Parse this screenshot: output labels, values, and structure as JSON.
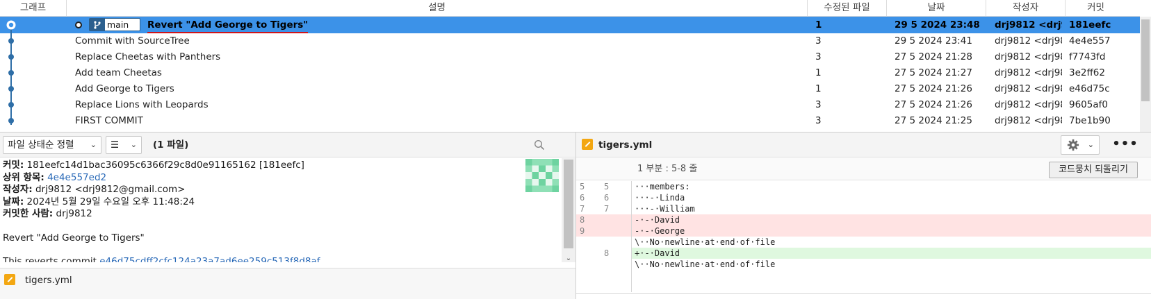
{
  "columns": {
    "graph": "그래프",
    "description": "설명",
    "files": "수정된 파일",
    "date": "날짜",
    "author": "작성자",
    "commit": "커밋"
  },
  "branch": {
    "name": "main",
    "icon": "branch-icon"
  },
  "commits": [
    {
      "message": "Revert \"Add George to Tigers\"",
      "files": "1",
      "date": "29 5 2024 23:48",
      "author": "drj9812 <drj9812",
      "hash": "181eefc",
      "selected": true
    },
    {
      "message": "Commit with SourceTree",
      "files": "3",
      "date": "29 5 2024 23:41",
      "author": "drj9812 <drj9812@",
      "hash": "4e4e557"
    },
    {
      "message": "Replace Cheetas with Panthers",
      "files": "3",
      "date": "27 5 2024 21:28",
      "author": "drj9812 <drj9812@",
      "hash": "f7743fd"
    },
    {
      "message": "Add team Cheetas",
      "files": "1",
      "date": "27 5 2024 21:27",
      "author": "drj9812 <drj9812@",
      "hash": "3e2ff62"
    },
    {
      "message": "Add George to Tigers",
      "files": "1",
      "date": "27 5 2024 21:26",
      "author": "drj9812 <drj9812@",
      "hash": "e46d75c"
    },
    {
      "message": "Replace Lions with Leopards",
      "files": "3",
      "date": "27 5 2024 21:26",
      "author": "drj9812 <drj9812@",
      "hash": "9605af0"
    },
    {
      "message": "FIRST COMMIT",
      "files": "3",
      "date": "27 5 2024 21:25",
      "author": "drj9812 <drj9812@",
      "hash": "7be1b90"
    }
  ],
  "left_toolbar": {
    "sort_label": "파일 상태순 정렬",
    "view_icon": "☰",
    "file_count": "(1 파일)"
  },
  "commit_details": {
    "commit_label": "커밋:",
    "commit_value": "181eefc14d1bac36095c6366f29c8d0e91165162 [181eefc]",
    "parent_label": "상위 항목:",
    "parent_value": "4e4e557ed2",
    "author_label": "작성자:",
    "author_value": "drj9812 <drj9812@gmail.com>",
    "date_label": "날짜:",
    "date_value": "2024년 5월 29일 수요일 오후 11:48:24",
    "committer_label": "커밋한 사람:",
    "committer_value": "drj9812",
    "message_title": "Revert \"Add George to Tigers\"",
    "message_body_prefix": "This reverts commit ",
    "message_body_link": "e46d75cdff2cfc124a23a7ad6ee259c513f8d8af",
    "message_body_suffix": "."
  },
  "changed_files": [
    {
      "name": "tigers.yml",
      "status_color": "#f3a712"
    }
  ],
  "diff_panel": {
    "file_name": "tigers.yml",
    "hunk_title": "1 부분 : 5-8 줄",
    "revert_button": "코드뭉치 되돌리기",
    "more_label": "•••",
    "lines": [
      {
        "old": "5",
        "new": "5",
        "type": "ctx",
        "text": "···members:"
      },
      {
        "old": "6",
        "new": "6",
        "type": "ctx",
        "text": "···-·Linda"
      },
      {
        "old": "7",
        "new": "7",
        "type": "ctx",
        "text": "···-·William"
      },
      {
        "old": "8",
        "new": "",
        "type": "del",
        "text": "-·-·David"
      },
      {
        "old": "9",
        "new": "",
        "type": "del",
        "text": "-·-·George"
      },
      {
        "old": "",
        "new": "",
        "type": "ctx",
        "text": "\\··No·newline·at·end·of·file"
      },
      {
        "old": "",
        "new": "8",
        "type": "add",
        "text": "+·-·David"
      },
      {
        "old": "",
        "new": "",
        "type": "ctx",
        "text": "\\··No·newline·at·end·of·file"
      }
    ]
  },
  "colors": {
    "selection": "#3c92e8",
    "graph_line": "#2e6ea7",
    "deleted_bg": "#ffe3e3",
    "added_bg": "#dff8df",
    "link": "#2a6ab8",
    "underline": "#d0151b"
  }
}
